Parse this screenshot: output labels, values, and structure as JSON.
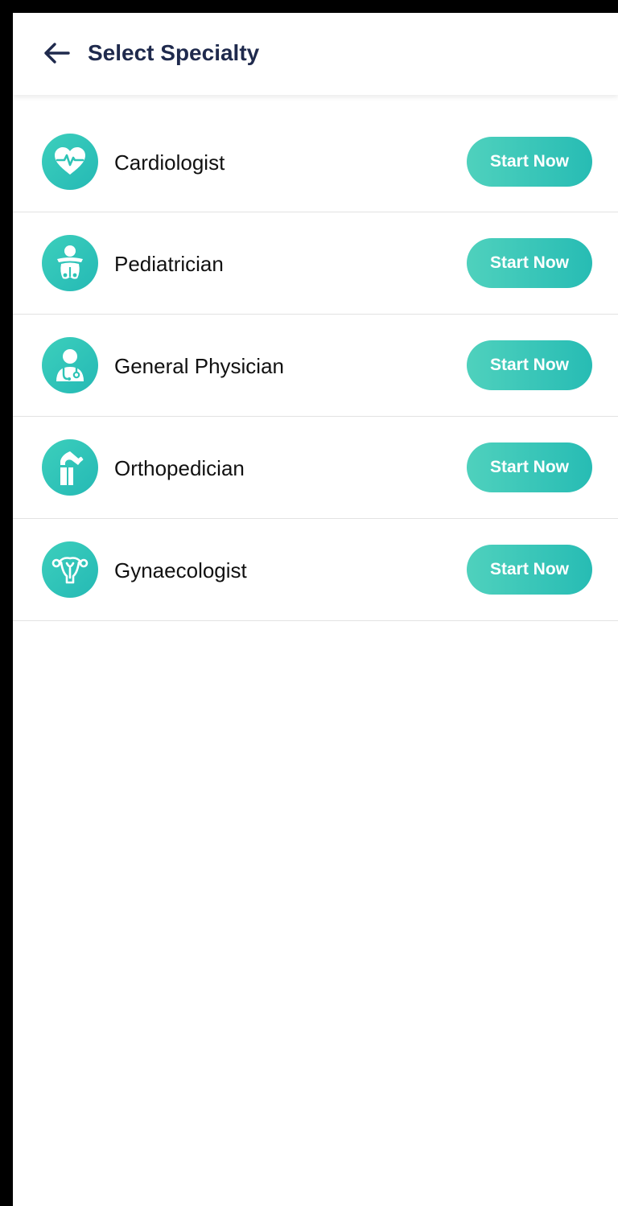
{
  "header": {
    "title": "Select Specialty",
    "back_icon": "arrow-left-icon"
  },
  "specialties": [
    {
      "label": "Cardiologist",
      "icon": "heart-pulse-icon",
      "button_label": "Start Now"
    },
    {
      "label": "Pediatrician",
      "icon": "baby-icon",
      "button_label": "Start Now"
    },
    {
      "label": "General Physician",
      "icon": "doctor-stethoscope-icon",
      "button_label": "Start Now"
    },
    {
      "label": "Orthopedician",
      "icon": "knee-bone-icon",
      "button_label": "Start Now"
    },
    {
      "label": "Gynaecologist",
      "icon": "uterus-icon",
      "button_label": "Start Now"
    }
  ],
  "colors": {
    "accent": "#2ec4b6",
    "accent_light": "#4fd1bd",
    "title": "#1f2a4d",
    "text": "#111111",
    "divider": "#e2e2e2"
  }
}
